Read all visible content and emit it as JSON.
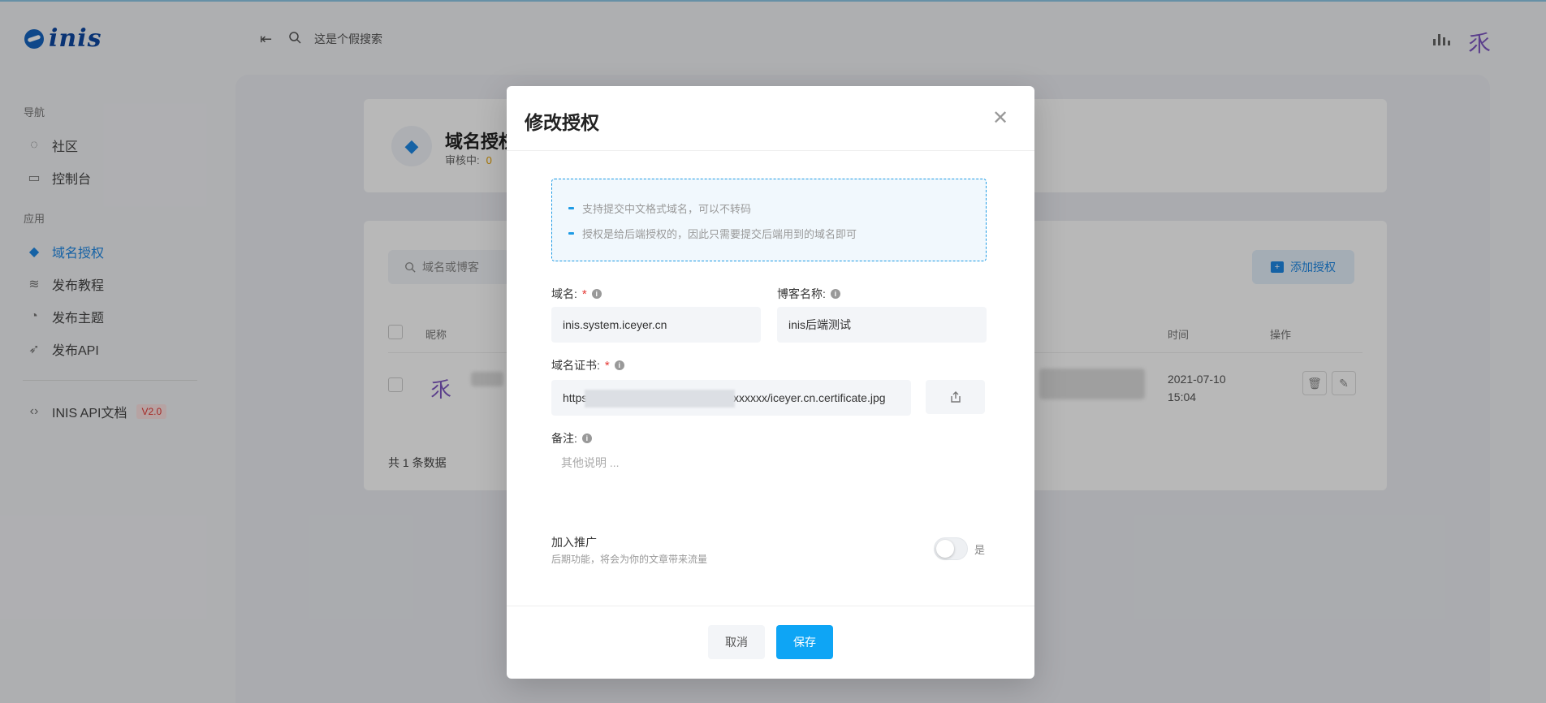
{
  "app": {
    "logo_text": "inis"
  },
  "topbar": {
    "search_placeholder": "这是个假搜索"
  },
  "sidebar": {
    "group_nav": "导航",
    "group_app": "应用",
    "items": [
      {
        "label": "社区",
        "icon": "planet-icon"
      },
      {
        "label": "控制台",
        "icon": "monitor-icon"
      },
      {
        "label": "域名授权",
        "icon": "diamond-icon",
        "active": true
      },
      {
        "label": "发布教程",
        "icon": "layers-icon"
      },
      {
        "label": "发布主题",
        "icon": "palette-icon"
      },
      {
        "label": "发布API",
        "icon": "rocket-icon"
      }
    ],
    "api_docs": {
      "label": "INIS API文档",
      "badge": "V2.0"
    }
  },
  "page": {
    "title": "域名授权",
    "pending_label": "审核中:",
    "pending_count": "0",
    "search_placeholder": "域名或博客",
    "add_button": "添加授权",
    "col_name": "昵称",
    "col_time": "时间",
    "col_ops": "操作",
    "row_time_date": "2021-07-10",
    "row_time_clock": "15:04",
    "total_text": "共 1 条数据"
  },
  "modal": {
    "title": "修改授权",
    "tips": [
      "支持提交中文格式域名，可以不转码",
      "授权是给后端授权的，因此只需要提交后端用到的域名即可"
    ],
    "domain_label": "域名:",
    "domain_value": "inis.system.iceyer.cn",
    "blog_label": "博客名称:",
    "blog_value": "inis后端测试",
    "cert_label": "域名证书:",
    "cert_value": "https://xxxxxxxxxxxxxxxxxxxxxxxxxxxxxx/iceyer.cn.certificate.jpg",
    "remark_label": "备注:",
    "remark_placeholder": "其他说明 ...",
    "promo_title": "加入推广",
    "promo_sub": "后期功能，将会为你的文章带来流量",
    "toggle_text": "是",
    "cancel": "取消",
    "save": "保存",
    "required_mark": "*"
  },
  "colors": {
    "accent": "#1e88e5",
    "save_button": "#0ea5f5",
    "tip_border": "#1e9be5"
  }
}
